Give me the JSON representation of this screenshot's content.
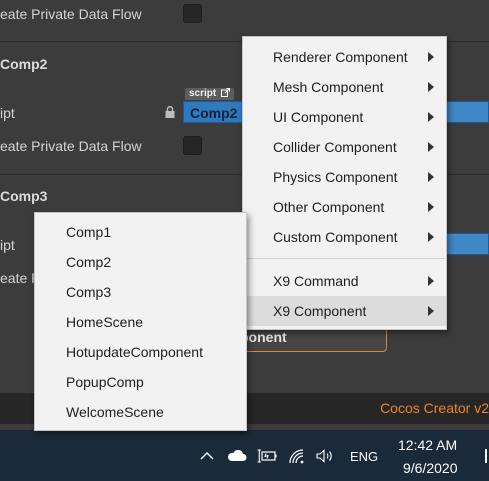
{
  "inspector": {
    "row1_label": "eate Private Data Flow",
    "comp2": {
      "title": "Comp2",
      "script_label": "ipt",
      "script_badge": "script",
      "script_value": "Comp2",
      "private_label": "eate Private Data Flow"
    },
    "comp3": {
      "title": "Comp3",
      "script_label": "ipt",
      "private_label": "eate P"
    },
    "add_component_label": "ponent"
  },
  "status_bar": {
    "brand": "Cocos Creator v2"
  },
  "context_menu": {
    "items": [
      {
        "label": "Renderer Component",
        "submenu": true
      },
      {
        "label": "Mesh Component",
        "submenu": true
      },
      {
        "label": "UI Component",
        "submenu": true
      },
      {
        "label": "Collider Component",
        "submenu": true
      },
      {
        "label": "Physics Component",
        "submenu": true
      },
      {
        "label": "Other Component",
        "submenu": true
      },
      {
        "label": "Custom Component",
        "submenu": true
      }
    ],
    "x9_items": [
      {
        "label": "X9 Command",
        "submenu": true
      },
      {
        "label": "X9 Component",
        "submenu": true,
        "highlighted": true
      }
    ]
  },
  "custom_submenu": {
    "items": [
      "Comp1",
      "Comp2",
      "Comp3",
      "HomeScene",
      "HotupdateComponent",
      "PopupComp",
      "WelcomeScene"
    ]
  },
  "taskbar": {
    "language": "ENG",
    "time": "12:42 AM",
    "date": "9/6/2020",
    "icons": [
      "chevron-up-icon",
      "cloud-icon",
      "battery-icon",
      "wifi-icon",
      "speaker-icon"
    ]
  },
  "colors": {
    "brand_orange": "#e8852c",
    "script_field_blue": "#2f79bf",
    "menu_background": "#f2f2f2",
    "menu_highlight": "#dcdcdc",
    "taskbar": "#1b2a3a"
  }
}
